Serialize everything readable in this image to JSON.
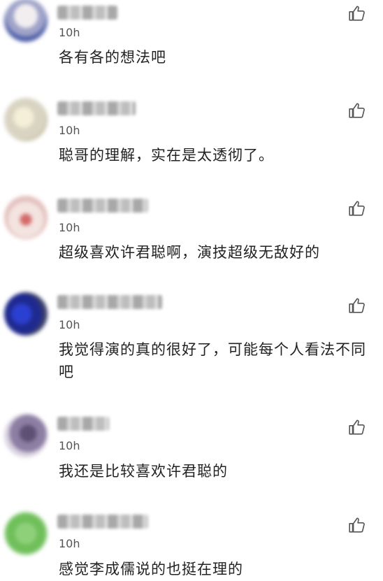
{
  "comments": [
    {
      "time": "10h",
      "text": "各有各的想法吧",
      "avatar_color": "#9fa3c9"
    },
    {
      "time": "10h",
      "text": "聪哥的理解，实在是太透彻了。",
      "avatar_color": "#d9d4c2"
    },
    {
      "time": "10h",
      "text": "超级喜欢许君聪啊，演技超级无敌好的",
      "avatar_color": "#e3c0bd"
    },
    {
      "time": "10h",
      "text": "我觉得演的真的很好了，可能每个人看法不同吧",
      "avatar_color": "#1f2a8f"
    },
    {
      "time": "10h",
      "text": "我还是比较喜欢许君聪的",
      "avatar_color": "#8d7ea3"
    },
    {
      "time": "10h",
      "text": "感觉李成儒说的也挺在理的",
      "avatar_color": "#6fbf5a"
    }
  ],
  "like_icon": "thumbs-up-icon"
}
